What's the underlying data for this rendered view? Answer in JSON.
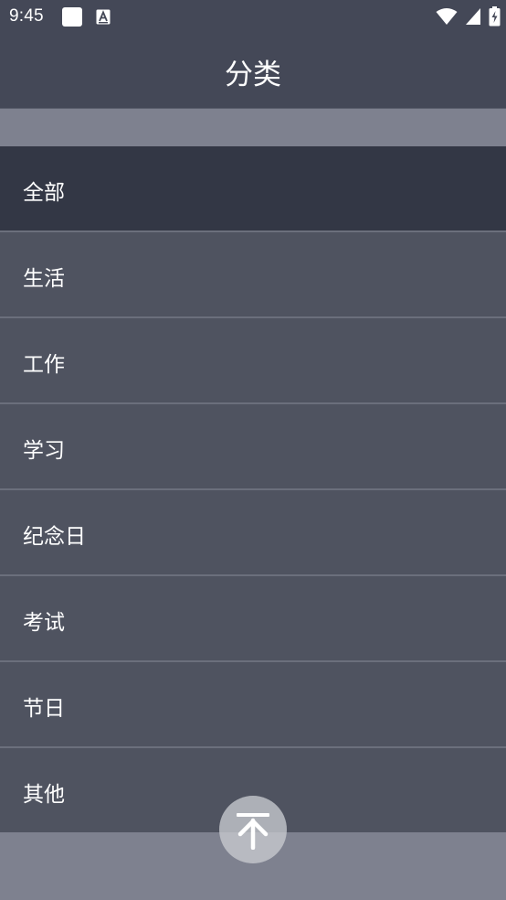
{
  "status_bar": {
    "time": "9:45",
    "icons": [
      "notification-square-icon",
      "keyboard-a-icon",
      "wifi-icon",
      "signal-icon",
      "battery-charging-icon"
    ]
  },
  "app_bar": {
    "title": "分类"
  },
  "categories": [
    {
      "label": "全部",
      "selected": true
    },
    {
      "label": "生活",
      "selected": false
    },
    {
      "label": "工作",
      "selected": false
    },
    {
      "label": "学习",
      "selected": false
    },
    {
      "label": "纪念日",
      "selected": false
    },
    {
      "label": "考试",
      "selected": false
    },
    {
      "label": "节日",
      "selected": false
    },
    {
      "label": "其他",
      "selected": false
    }
  ],
  "fab": {
    "icon": "arrow-to-top-icon"
  },
  "colors": {
    "bar": "#444857",
    "item": "#4f5360",
    "item_selected": "#333745",
    "background": "#7e818f",
    "text": "#ffffff"
  }
}
